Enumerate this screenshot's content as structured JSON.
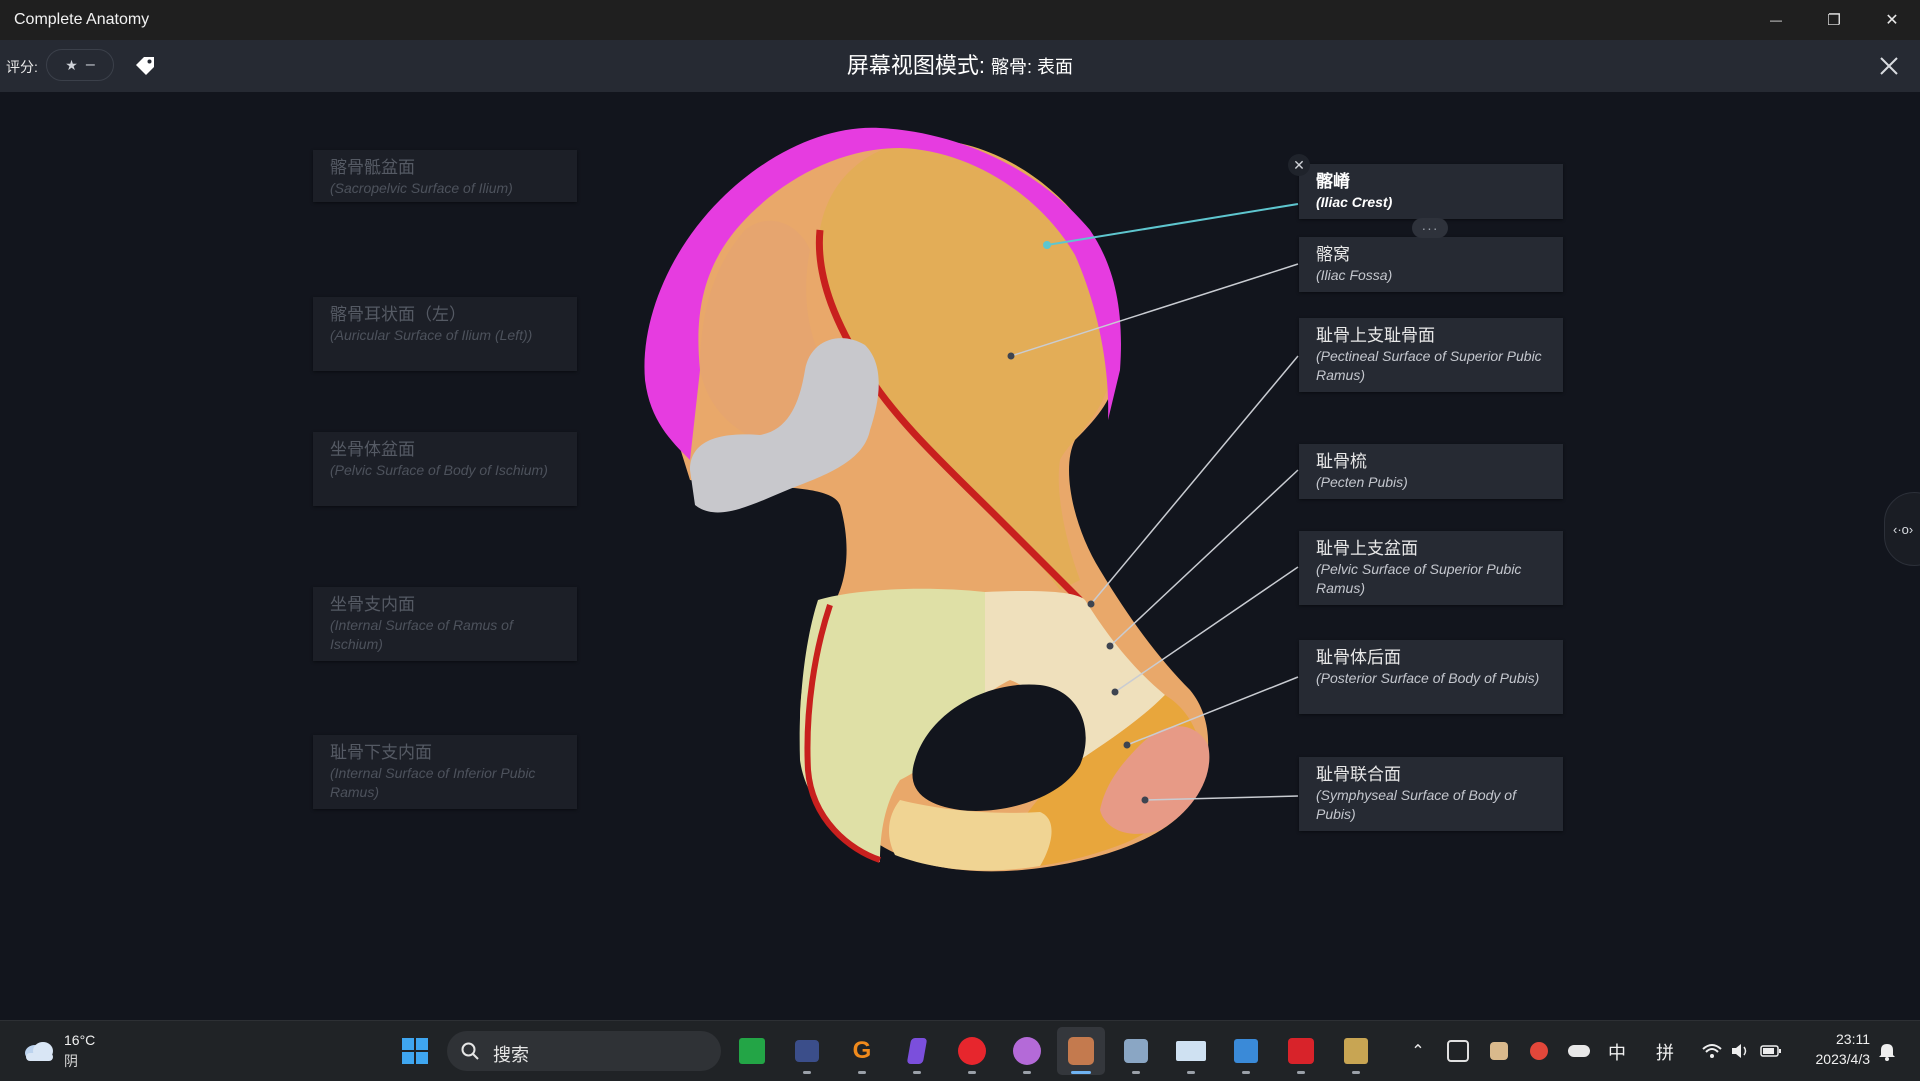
{
  "window": {
    "title": "Complete Anatomy",
    "minimize_glyph": "—",
    "restore_glyph": "❐",
    "close_glyph": "✕"
  },
  "toolbar": {
    "rating_label": "评分:",
    "rating_star": "★",
    "rating_value": "–",
    "title_main": "屏幕视图模式:",
    "title_sub": "髂骨: 表面",
    "close_icon": "close-icon",
    "tag_icon": "tag-icon"
  },
  "left_labels": [
    {
      "cn": "髂骨骶盆面",
      "en": "(Sacropelvic Surface of Ilium)"
    },
    {
      "cn": "髂骨耳状面（左）",
      "en": "(Auricular Surface of Ilium (Left))"
    },
    {
      "cn": "坐骨体盆面",
      "en": "(Pelvic Surface of Body of Ischium)"
    },
    {
      "cn": "坐骨支内面",
      "en": "(Internal Surface of Ramus of Ischium)"
    },
    {
      "cn": "耻骨下支内面",
      "en": "(Internal Surface of Inferior Pubic Ramus)"
    }
  ],
  "right_labels": [
    {
      "cn": "髂嵴",
      "en": "(Iliac Crest)"
    },
    {
      "cn": "髂窝",
      "en": "(Iliac Fossa)"
    },
    {
      "cn": "耻骨上支耻骨面",
      "en": "(Pectineal Surface of Superior Pubic Ramus)"
    },
    {
      "cn": "耻骨梳",
      "en": "(Pecten Pubis)"
    },
    {
      "cn": "耻骨上支盆面",
      "en": "(Pelvic Surface of Superior Pubic Ramus)"
    },
    {
      "cn": "耻骨体后面",
      "en": "(Posterior Surface of Body of Pubis)"
    },
    {
      "cn": "耻骨联合面",
      "en": "(Symphyseal Surface of Body of Pubis)"
    }
  ],
  "callout": {
    "close_glyph": "✕",
    "more_glyph": "···"
  },
  "side_handle": {
    "glyph": "‹·o›"
  },
  "colors": {
    "iliac_crest": "#e63ce0",
    "iliac_fossa": "#e3ad57",
    "sacropelvic": "#e9a86a",
    "auricular": "#c8c8cc",
    "border_red": "#c8201e",
    "ischium": "#dfe0a6",
    "pubis_light": "#efe0bc",
    "pubis_orange": "#e8a63c",
    "symphyseal": "#e79a86",
    "leader_active": "#5ec6cf",
    "leader": "#c9ccd2"
  },
  "taskbar": {
    "weather_temp": "16°C",
    "weather_desc": "阴",
    "search_placeholder": "搜索",
    "apps": [
      "windows-start-icon",
      "calculator-icon",
      "cat-app-icon",
      "g-app-icon",
      "obsidian-icon",
      "netease-music-icon",
      "purple-app-icon",
      "complete-anatomy-icon",
      "star-app-icon",
      "chart-app-icon",
      "editor-app-icon",
      "acrobat-icon",
      "lol-icon"
    ],
    "tray_ime_mode": "中",
    "tray_ime_pinyin": "拼",
    "time": "23:11",
    "date": "2023/4/3"
  }
}
